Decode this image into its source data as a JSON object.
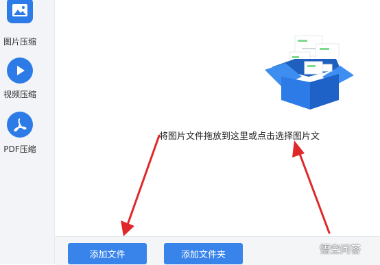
{
  "sidebar": {
    "items": [
      {
        "label": "图片压缩",
        "icon": "image-icon"
      },
      {
        "label": "视频压缩",
        "icon": "play-icon"
      },
      {
        "label": "PDF压缩",
        "icon": "pdf-icon"
      }
    ]
  },
  "main": {
    "drop_text": "将图片文件拖放到这里或点击选择图片文"
  },
  "buttons": {
    "add_file": "添加文件",
    "add_folder": "添加文件夹"
  },
  "watermark": "悟空问答",
  "colors": {
    "accent": "#2d7be6",
    "arrow": "#e0282a"
  }
}
